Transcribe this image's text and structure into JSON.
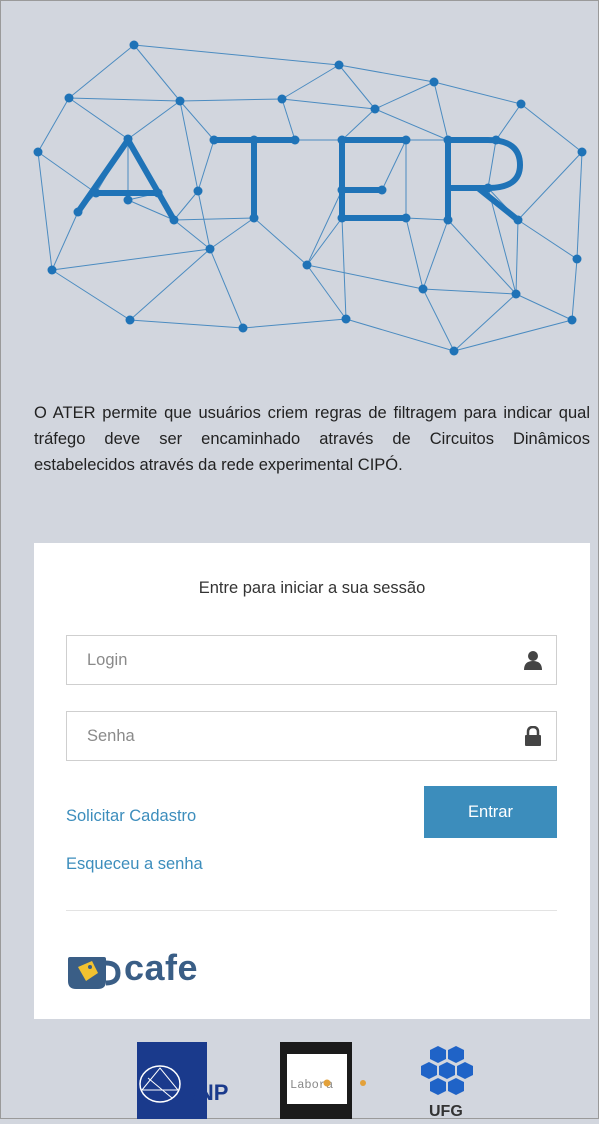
{
  "app": {
    "logo_text": "ATER",
    "description": "O ATER permite que usuários criem regras de filtragem para indicar qual tráfego deve ser encaminhado através de Circuitos Dinâmicos estabelecidos através da rede experimental CIPÓ."
  },
  "login": {
    "title": "Entre para iniciar a sua sessão",
    "login_placeholder": "Login",
    "password_placeholder": "Senha",
    "login_value": "",
    "password_value": "",
    "submit_label": "Entrar",
    "register_link": "Solicitar Cadastro",
    "forgot_link": "Esqueceu a senha",
    "cafe_label": "cafe"
  },
  "footer": {
    "logos": [
      "RNP",
      "Labora",
      "UFG"
    ]
  },
  "colors": {
    "background": "#d2d6de",
    "accent": "#3c8dbc",
    "network": "#1f73b7"
  },
  "icons": {
    "login_field": "user-icon",
    "password_field": "lock-icon"
  }
}
